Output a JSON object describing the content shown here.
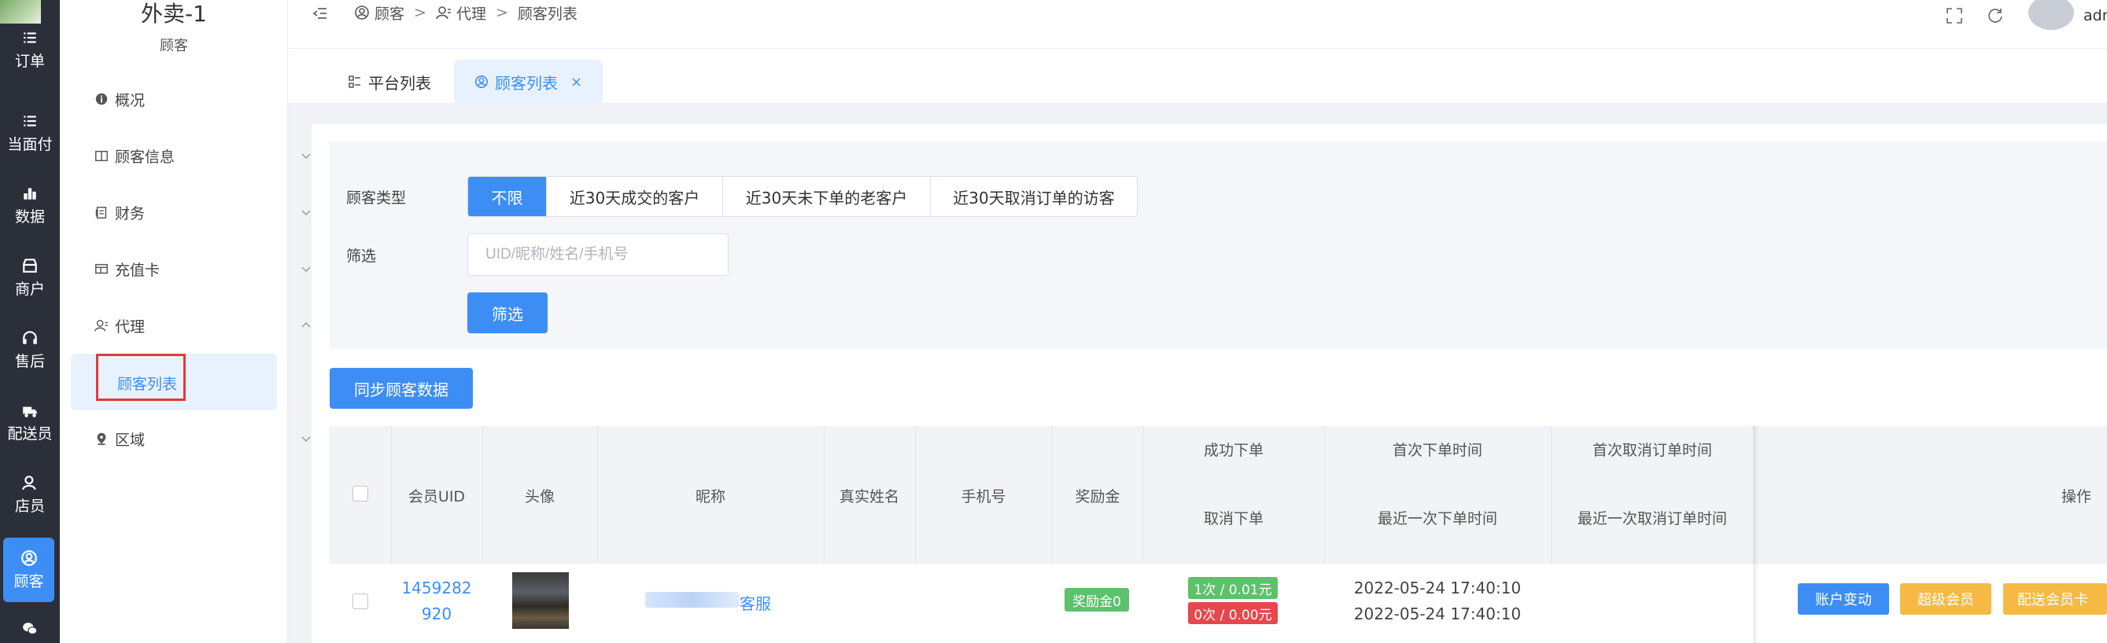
{
  "rail": {
    "items": [
      {
        "label": "订单",
        "icon": "list-icon"
      },
      {
        "label": "当面付",
        "icon": "list-icon"
      },
      {
        "label": "数据",
        "icon": "bar-chart-icon"
      },
      {
        "label": "商户",
        "icon": "store-icon"
      },
      {
        "label": "售后",
        "icon": "headset-icon"
      },
      {
        "label": "配送员",
        "icon": "delivery-icon"
      },
      {
        "label": "店员",
        "icon": "staff-icon"
      },
      {
        "label": "顾客",
        "icon": "customer-icon"
      }
    ],
    "active_index": 7,
    "accent": "#3d8ef4"
  },
  "sidebar": {
    "title": "外卖-1",
    "subtitle": "顾客",
    "menu": [
      {
        "label": "概况",
        "icon": "info-icon"
      },
      {
        "label": "顾客信息",
        "icon": "book-icon"
      },
      {
        "label": "财务",
        "icon": "finance-icon"
      },
      {
        "label": "充值卡",
        "icon": "card-icon"
      },
      {
        "label": "代理",
        "icon": "agent-icon"
      },
      {
        "label": "区域",
        "icon": "location-icon"
      }
    ],
    "active_sub": "顾客列表"
  },
  "header": {
    "breadcrumb": [
      "顾客",
      "代理",
      "顾客列表"
    ],
    "username": "admin"
  },
  "tabs": [
    {
      "label": "平台列表",
      "active": false
    },
    {
      "label": "顾客列表",
      "active": true
    }
  ],
  "filter": {
    "type_label": "顾客类型",
    "type_options": [
      "不限",
      "近30天成交的客户",
      "近30天未下单的老客户",
      "近30天取消订单的访客"
    ],
    "type_selected": 0,
    "search_label": "筛选",
    "search_placeholder": "UID/昵称/姓名/手机号",
    "search_button": "筛选"
  },
  "sync_button": "同步顾客数据",
  "table": {
    "headers": {
      "uid": "会员UID",
      "avatar": "头像",
      "nickname": "昵称",
      "realname": "真实姓名",
      "phone": "手机号",
      "bonus": "奖励金",
      "success_orders": "成功下单",
      "cancel_orders": "取消下单",
      "first_order_time": "首次下单时间",
      "last_order_time": "最近一次下单时间",
      "first_cancel_time": "首次取消订单时间",
      "last_cancel_time": "最近一次取消订单时间",
      "actions": "操作"
    },
    "rows": [
      {
        "uid_line1": "1459282",
        "uid_line2": "920",
        "nickname_suffix": "客服",
        "realname": "",
        "phone": "",
        "bonus_tag": "奖励金0",
        "success_tag": "1次 / 0.01元",
        "cancel_tag": "0次 / 0.00元",
        "first_order_time": "2022-05-24 17:40:10",
        "last_order_time": "2022-05-24 17:40:10",
        "actions": [
          "账户变动",
          "超级会员",
          "配送会员卡"
        ]
      }
    ]
  },
  "colors": {
    "primary": "#3d8ef4",
    "success": "#5cc26b",
    "danger": "#e5484d",
    "warning": "#f5b944"
  }
}
